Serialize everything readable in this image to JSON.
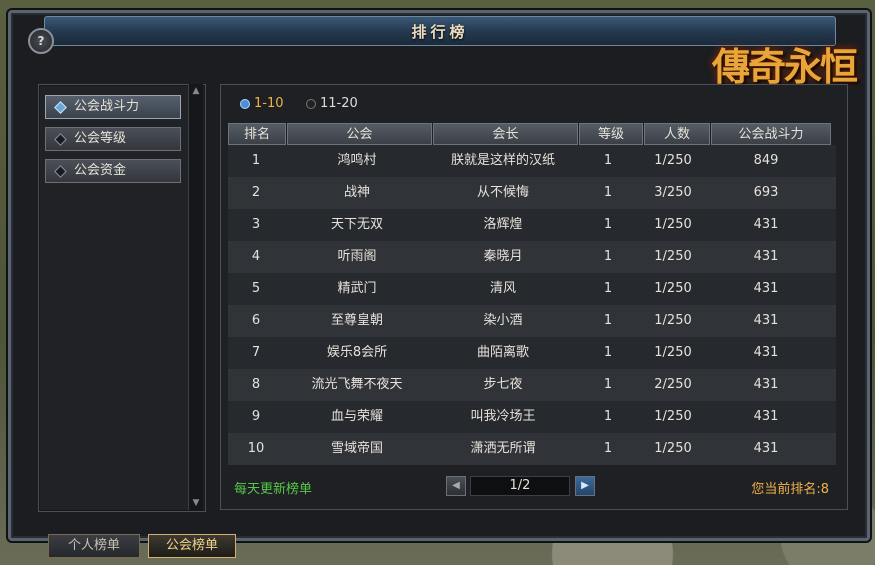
{
  "window": {
    "title": "排行榜",
    "help": "?",
    "logo": "傳奇永恒"
  },
  "sidebar": {
    "items": [
      {
        "label": "公会战斗力",
        "active": true
      },
      {
        "label": "公会等级",
        "active": false
      },
      {
        "label": "公会资金",
        "active": false
      }
    ]
  },
  "range": {
    "options": [
      "1-10",
      "11-20"
    ],
    "selected": "1-10"
  },
  "table": {
    "headers": [
      "排名",
      "公会",
      "会长",
      "等级",
      "人数",
      "公会战斗力"
    ],
    "rows": [
      [
        "1",
        "鸿鸣村",
        "朕就是这样的汉纸",
        "1",
        "1/250",
        "849"
      ],
      [
        "2",
        "战神",
        "从不候悔",
        "1",
        "3/250",
        "693"
      ],
      [
        "3",
        "天下无双",
        "洛辉煌",
        "1",
        "1/250",
        "431"
      ],
      [
        "4",
        "听雨阁",
        "秦晓月",
        "1",
        "1/250",
        "431"
      ],
      [
        "5",
        "精武门",
        "清风",
        "1",
        "1/250",
        "431"
      ],
      [
        "6",
        "至尊皇朝",
        "染小酒",
        "1",
        "1/250",
        "431"
      ],
      [
        "7",
        "娱乐8会所",
        "曲陌离歌",
        "1",
        "1/250",
        "431"
      ],
      [
        "8",
        "流光飞舞不夜天",
        "步七夜",
        "1",
        "2/250",
        "431"
      ],
      [
        "9",
        "血与荣耀",
        "叫我冷场王",
        "1",
        "1/250",
        "431"
      ],
      [
        "10",
        "雪域帝国",
        "潇洒无所谓",
        "1",
        "1/250",
        "431"
      ]
    ]
  },
  "footer": {
    "note": "每天更新榜单",
    "page": "1/2",
    "my_rank": "您当前排名:8"
  },
  "bottom_tabs": [
    {
      "label": "个人榜单",
      "active": false
    },
    {
      "label": "公会榜单",
      "active": true
    }
  ]
}
